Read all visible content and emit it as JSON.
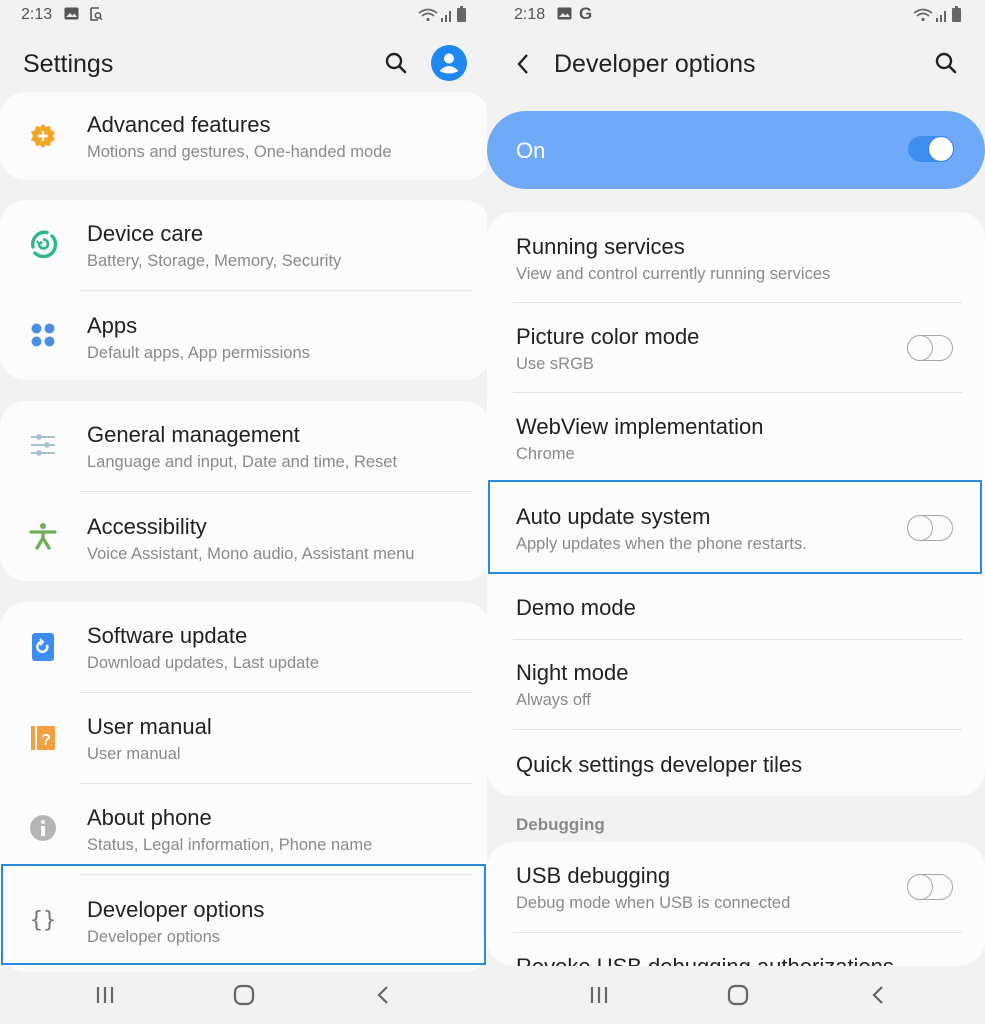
{
  "left": {
    "status": {
      "time": "2:13",
      "icons": [
        "image-icon",
        "screenshot-search-icon"
      ],
      "right_icons": [
        "wifi-icon",
        "signal-icon",
        "battery-icon"
      ]
    },
    "appbar": {
      "title": "Settings",
      "actions": [
        "search-icon",
        "profile-icon"
      ]
    },
    "groups": [
      {
        "items": [
          {
            "title": "Advanced features",
            "subtitle": "Motions and gestures, One-handed mode",
            "icon": "advanced-features-icon",
            "color": "#f5a623"
          }
        ]
      },
      {
        "items": [
          {
            "title": "Device care",
            "subtitle": "Battery, Storage, Memory, Security",
            "icon": "device-care-icon",
            "color": "#2fb592"
          },
          {
            "title": "Apps",
            "subtitle": "Default apps, App permissions",
            "icon": "apps-icon",
            "color": "#4a90e2"
          }
        ]
      },
      {
        "items": [
          {
            "title": "General management",
            "subtitle": "Language and input, Date and time, Reset",
            "icon": "sliders-icon",
            "color": "#a9c0cf"
          },
          {
            "title": "Accessibility",
            "subtitle": "Voice Assistant, Mono audio, Assistant menu",
            "icon": "accessibility-icon",
            "color": "#6fae5a"
          }
        ]
      },
      {
        "items": [
          {
            "title": "Software update",
            "subtitle": "Download updates, Last update",
            "icon": "software-update-icon",
            "color": "#3e8ef0"
          },
          {
            "title": "User manual",
            "subtitle": "User manual",
            "icon": "user-manual-icon",
            "color": "#f5a040"
          },
          {
            "title": "About phone",
            "subtitle": "Status, Legal information, Phone name",
            "icon": "info-icon",
            "color": "#b5b5b5"
          },
          {
            "title": "Developer options",
            "subtitle": "Developer options",
            "icon": "braces-icon",
            "color": "#777777"
          }
        ]
      }
    ],
    "highlighted": "Developer options"
  },
  "right": {
    "status": {
      "time": "2:18",
      "icons": [
        "image-icon",
        "google-icon"
      ],
      "right_icons": [
        "wifi-icon",
        "signal-icon",
        "battery-icon"
      ]
    },
    "appbar": {
      "title": "Developer options",
      "actions": [
        "back-icon",
        "search-icon"
      ]
    },
    "master_switch": {
      "label": "On",
      "checked": true,
      "color": "#6eaaf8"
    },
    "items": [
      {
        "title": "Running services",
        "subtitle": "View and control currently running services",
        "toggle": null
      },
      {
        "title": "Picture color mode",
        "subtitle": "Use sRGB",
        "toggle": false
      },
      {
        "title": "WebView implementation",
        "subtitle": "Chrome",
        "toggle": null
      },
      {
        "title": "Auto update system",
        "subtitle": "Apply updates when the phone restarts.",
        "toggle": false
      },
      {
        "title": "Demo mode",
        "subtitle": "",
        "toggle": null
      },
      {
        "title": "Night mode",
        "subtitle": "Always off",
        "toggle": null
      },
      {
        "title": "Quick settings developer tiles",
        "subtitle": "",
        "toggle": null
      }
    ],
    "debugging": {
      "header": "Debugging",
      "items": [
        {
          "title": "USB debugging",
          "subtitle": "Debug mode when USB is connected",
          "toggle": false
        },
        {
          "title": "Revoke USB debugging authorizations",
          "subtitle": "",
          "toggle": null
        }
      ]
    },
    "highlighted": "Auto update system"
  },
  "navbar": {
    "buttons": [
      "recents-icon",
      "home-icon",
      "back-icon"
    ]
  },
  "accent_color": "#2a8ae0"
}
